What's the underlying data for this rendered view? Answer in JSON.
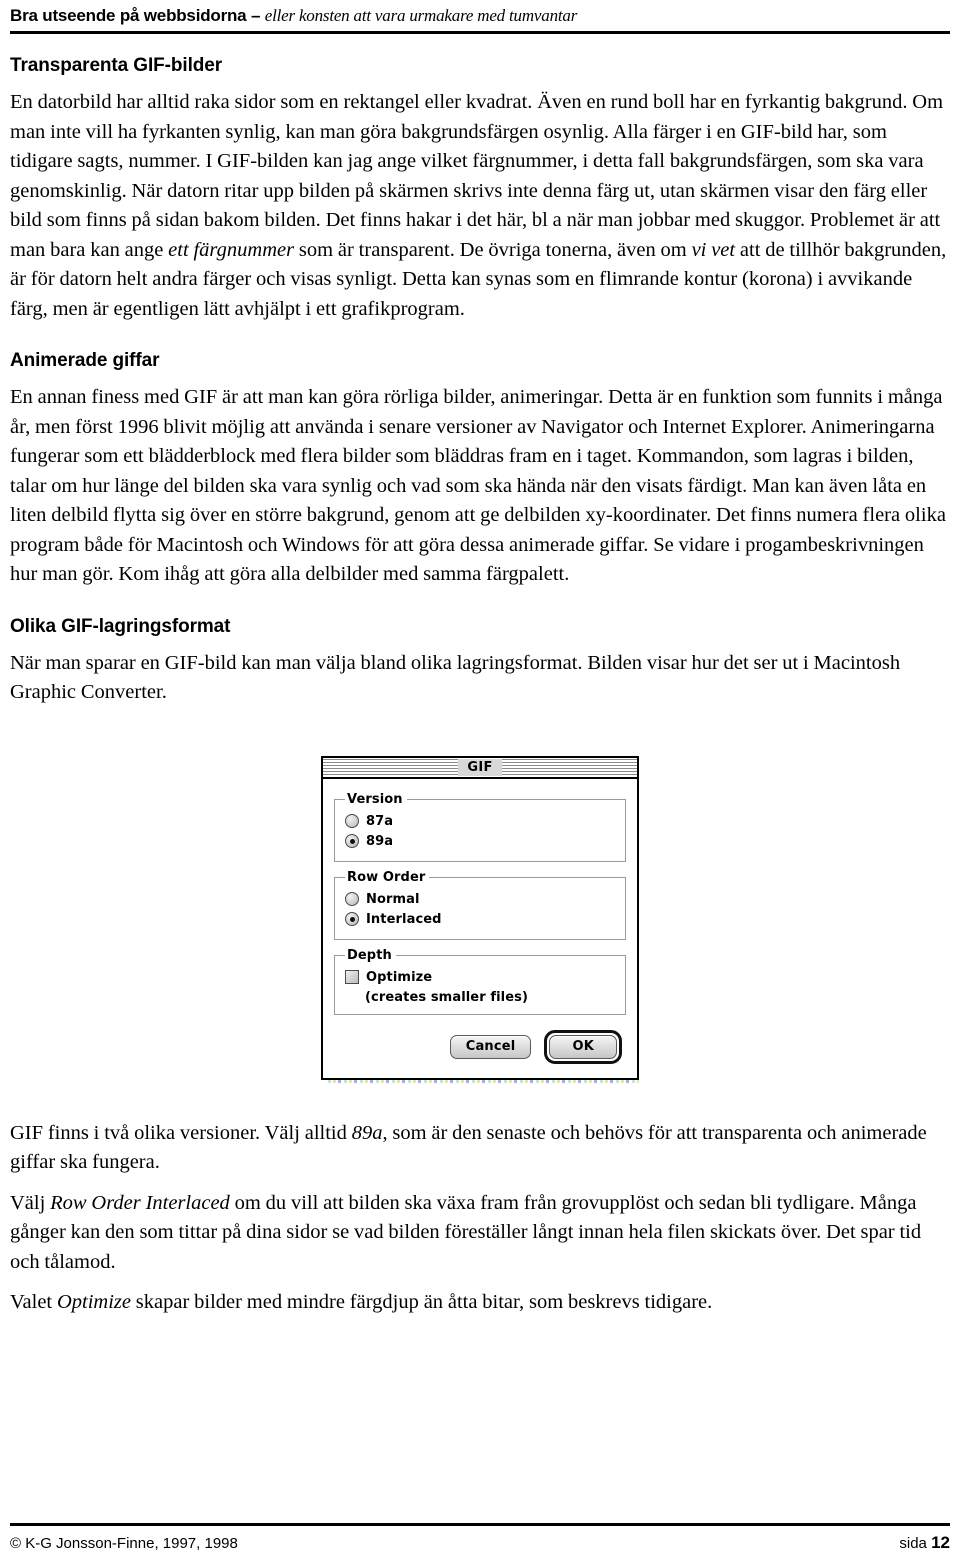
{
  "header": {
    "title": "Bra utseende på webbsidorna –",
    "subtitle": "eller konsten att vara urmakare med tumvantar"
  },
  "sections": [
    {
      "heading": "Transparenta GIF-bilder",
      "paragraphs": [
        "En datorbild  har alltid raka sidor som en rektangel eller kvadrat. Även en rund boll har en fyrkantig bakgrund. Om man inte vill ha fyrkanten synlig, kan man göra bakgrundsfärgen osynlig. Alla färger i en GIF-bild har, som tidigare sagts, nummer. I GIF-bilden kan jag ange vilket färgnummer, i detta fall bakgrundsfärgen, som ska vara genomskinlig. När datorn ritar upp bilden på skärmen skrivs inte denna färg ut, utan skärmen visar den färg eller bild som finns på sidan bakom bilden. Det finns hakar i det här, bl a när man jobbar med skuggor. Problemet är att  man bara kan ange "
      ]
    }
  ],
  "para1": {
    "part1": "En datorbild  har alltid raka sidor som en rektangel eller kvadrat. Även en rund boll har en fyrkantig bakgrund. Om man inte vill ha fyrkanten synlig, kan man göra bakgrundsfärgen osynlig. Alla färger i en GIF-bild har, som tidigare sagts, nummer. I GIF-bilden kan jag ange vilket färgnummer, i detta fall bakgrundsfärgen, som ska vara genomskinlig. När datorn ritar upp bilden på skärmen skrivs inte denna färg ut, utan skärmen visar den färg eller bild som finns på sidan bakom bilden. Det finns hakar i det här, bl a när man jobbar med skuggor. Problemet är att  man bara kan ange ",
    "em1": "ett färgnummer",
    "part2": " som är transparent. De övriga tonerna, även om ",
    "em2": "vi vet",
    "part3": " att de tillhör bakgrunden, är för datorn helt andra färger och visas synligt. Detta kan synas som en flimrande kontur (korona) i avvikande färg, men är egentligen lätt avhjälpt i ett grafikprogram."
  },
  "heading1": "Transparenta GIF-bilder",
  "heading2": "Animerade giffar",
  "heading3": "Olika GIF-lagringsformat",
  "para2": "En annan finess med GIF är att man kan göra rörliga bilder, animeringar. Detta är en funktion som funnits i många år, men först 1996 blivit möjlig att använda i senare versioner av Navigator och Internet Explorer. Animeringarna fungerar som ett blädderblock med flera bilder som bläddras fram en i taget. Kommandon, som lagras i bilden, talar om hur länge del bilden ska vara synlig och vad som ska hända när den visats färdigt. Man kan även låta en liten delbild flytta sig över en större bakgrund, genom att ge delbilden xy-koordinater. Det finns numera flera olika program både för Macintosh och Windows för att göra dessa animerade giffar. Se vidare i progambeskrivningen hur man gör. Kom ihåg att göra alla delbilder med samma färgpalett.",
  "para3": "När man sparar en GIF-bild kan man välja bland olika lagringsformat. Bilden visar hur det ser ut i Macintosh Graphic Converter.",
  "para4": {
    "part1": "GIF finns i två olika versioner. Välj alltid ",
    "em1": "89a",
    "part2": ", som är den senaste och behövs för att transparenta och animerade giffar ska fungera."
  },
  "para5": {
    "part1": "Välj ",
    "em1": "Row Order Interlaced",
    "part2": " om du vill att bilden ska växa fram från grovupplöst och sedan bli tydligare. Många gånger kan den som tittar på dina sidor se vad bilden föreställer långt innan hela filen skickats över. Det spar tid och tålamod."
  },
  "para6": {
    "part1": "Valet ",
    "em1": "Optimize",
    "part2": " skapar bilder med mindre färgdjup än åtta bitar, som beskrevs tidigare."
  },
  "dialog": {
    "title": "GIF",
    "groups": [
      {
        "legend": "Version",
        "options": [
          {
            "label": "87a",
            "type": "radio",
            "checked": false
          },
          {
            "label": "89a",
            "type": "radio",
            "checked": true
          }
        ]
      },
      {
        "legend": "Row Order",
        "options": [
          {
            "label": "Normal",
            "type": "radio",
            "checked": false
          },
          {
            "label": "Interlaced",
            "type": "radio",
            "checked": true
          }
        ]
      },
      {
        "legend": "Depth",
        "options": [
          {
            "label": "Optimize",
            "type": "checkbox",
            "checked": false
          }
        ],
        "note": "(creates smaller files)"
      }
    ],
    "version_legend": "Version",
    "version_opt1": "87a",
    "version_opt2": "89a",
    "roworder_legend": "Row Order",
    "roworder_opt1": "Normal",
    "roworder_opt2": "Interlaced",
    "depth_legend": "Depth",
    "depth_opt1": "Optimize",
    "depth_note": "(creates smaller files)",
    "cancel_label": "Cancel",
    "ok_label": "OK"
  },
  "footer": {
    "copyright": "© K-G Jonsson-Finne, 1997, 1998",
    "page_word": "sida",
    "page_number": "12"
  },
  "colors": {
    "text": "#000000",
    "background": "#ffffff",
    "rule": "#000000",
    "dialog_chrome": "#d4d4d4"
  }
}
